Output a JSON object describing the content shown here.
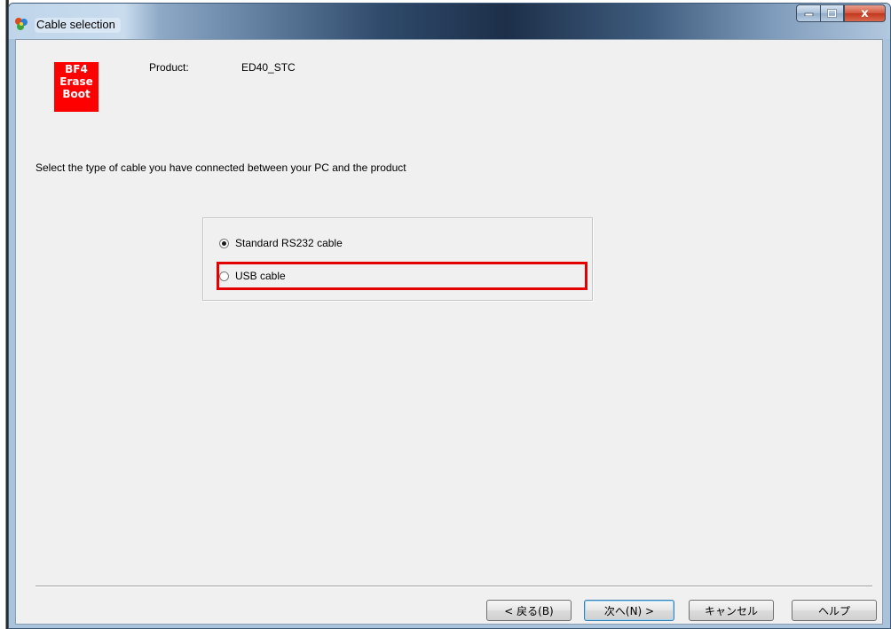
{
  "window": {
    "title": "Cable selection",
    "close_glyph": "x"
  },
  "logo": {
    "line1": "BF4",
    "line2": "Erase",
    "line3": "Boot",
    "color": "#ff0000"
  },
  "product": {
    "label": "Product:",
    "value": "ED40_STC"
  },
  "instruction": "Select the type of cable you have connected between your PC and the product",
  "cable_options": [
    {
      "label": "Standard RS232 cable",
      "selected": true
    },
    {
      "label": "USB cable",
      "selected": false
    }
  ],
  "highlight_color": "#e20000",
  "buttons": {
    "back": "< 戻る(B)",
    "next": "次へ(N) >",
    "cancel": "キャンセル",
    "help": "ヘルプ"
  }
}
